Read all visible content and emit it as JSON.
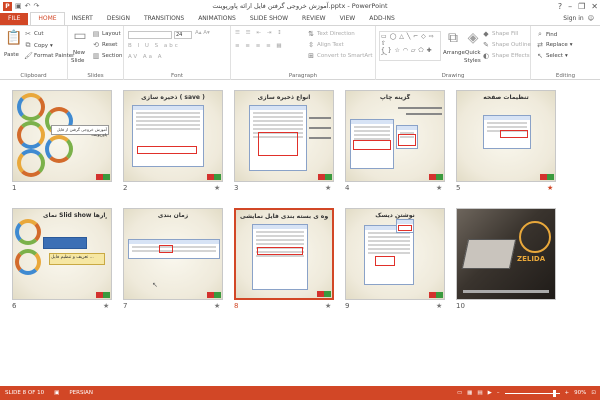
{
  "window": {
    "title": "آموزش خروجی گرفتن فایل ارائه پاورپوینت.pptx - PowerPoint",
    "minimize": "–",
    "restore": "❐",
    "close": "✕"
  },
  "qat": {
    "app_icon": "P",
    "save_icon": "floppy-icon",
    "undo_icon": "undo-icon",
    "redo_icon": "redo-icon"
  },
  "tabs": [
    "FILE",
    "HOME",
    "INSERT",
    "DESIGN",
    "TRANSITIONS",
    "ANIMATIONS",
    "SLIDE SHOW",
    "REVIEW",
    "VIEW",
    "ADD-INS"
  ],
  "active_tab": "HOME",
  "signin": "Sign in",
  "ribbon": {
    "clipboard": {
      "paste": "Paste",
      "cut": "Cut",
      "copy": "Copy",
      "format_painter": "Format Painter",
      "label": "Clipboard"
    },
    "slides": {
      "new_slide": "New",
      "new_slide2": "Slide",
      "layout": "Layout",
      "reset": "Reset",
      "section": "Section",
      "label": "Slides"
    },
    "font": {
      "size": "24",
      "label": "Font"
    },
    "paragraph": {
      "text_direction": "Text Direction",
      "align_text": "Align Text",
      "convert": "Convert to SmartArt",
      "label": "Paragraph"
    },
    "drawing": {
      "arrange": "Arrange",
      "quick_styles": "Quick",
      "quick_styles2": "Styles",
      "shape_fill": "Shape Fill",
      "shape_outline": "Shape Outline",
      "shape_effects": "Shape Effects",
      "label": "Drawing"
    },
    "editing": {
      "find": "Find",
      "replace": "Replace",
      "select": "Select",
      "label": "Editing"
    }
  },
  "slides": [
    {
      "num": "1",
      "title": "",
      "star": "",
      "body": "آموزش خروجی گرفتن از فایل پاورپوینت"
    },
    {
      "num": "2",
      "title": "ذخیره سازی ( save )",
      "star": "★",
      "body": ""
    },
    {
      "num": "3",
      "title": "انواع ذخیره سازی",
      "star": "★",
      "body": ""
    },
    {
      "num": "4",
      "title": "گزینه چاپ",
      "star": "★",
      "body": ""
    },
    {
      "num": "5",
      "title": "تنظیمات صفحه",
      "star": "★",
      "body": ""
    },
    {
      "num": "6",
      "title": "نمای Slid show و ابزارها",
      "star": "★",
      "body": "تعریف و تنظیم فایل ..."
    },
    {
      "num": "7",
      "title": "زمان بندی",
      "star": "★",
      "body": ""
    },
    {
      "num": "8",
      "title": "نحوه ی بسته بندی فایل نمایشی",
      "star": "★",
      "body": ""
    },
    {
      "num": "9",
      "title": "نوشتن دیسک",
      "star": "★",
      "body": ""
    },
    {
      "num": "10",
      "title": "",
      "star": "",
      "body": "ZELIDA"
    }
  ],
  "status": {
    "slide_info": "SLIDE 8 OF 10",
    "language": "PERSIAN",
    "zoom": "90%",
    "zoom_minus": "–",
    "zoom_plus": "+"
  }
}
